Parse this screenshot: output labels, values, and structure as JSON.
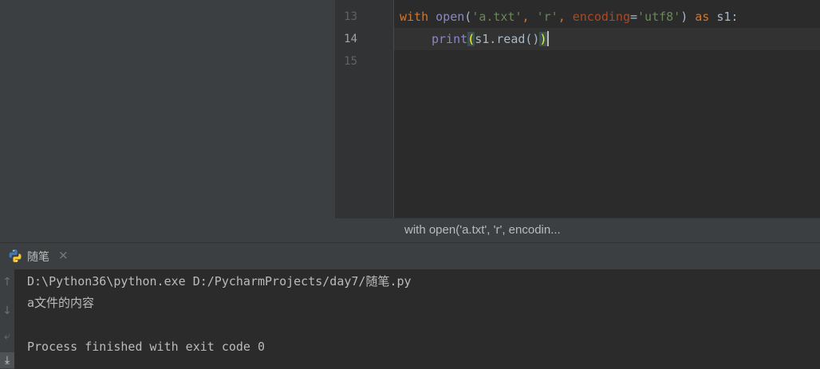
{
  "editor": {
    "lines": [
      {
        "number": "13"
      },
      {
        "number": "14"
      },
      {
        "number": "15"
      }
    ],
    "code": {
      "line13": {
        "kw_with": "with",
        "fn_open": "open",
        "paren_open": "(",
        "str_file": "'a.txt'",
        "comma1": ", ",
        "str_mode": "'r'",
        "comma2": ", ",
        "param_encoding": "encoding",
        "equals": "=",
        "str_enc": "'utf8'",
        "paren_close": ") ",
        "kw_as": "as",
        "var": " s1:"
      },
      "line14": {
        "fn_print": "print",
        "paren_open": "(",
        "call": "s1.read()",
        "paren_close": ")"
      }
    }
  },
  "breadcrumb": {
    "text": "with open('a.txt', 'r', encodin..."
  },
  "run_window": {
    "tab_label": "随笔",
    "tab_close": "×",
    "toolbar": [
      {
        "icon": "arrow-up-icon",
        "glyph": "↑"
      },
      {
        "icon": "arrow-down-icon",
        "glyph": "↓"
      },
      {
        "icon": "soft-wrap-icon",
        "glyph": "⤶"
      },
      {
        "icon": "scroll-to-end-icon",
        "glyph": "⤓"
      }
    ],
    "console": [
      "D:\\Python36\\python.exe D:/PycharmProjects/day7/随笔.py",
      "a文件的内容",
      "",
      "Process finished with exit code 0"
    ]
  },
  "colors": {
    "keyword": "#cc7832",
    "builtin": "#8888c6",
    "string": "#6a8759",
    "param": "#aa4926",
    "text": "#a9b7c6",
    "brace_match": "#ffef28"
  }
}
